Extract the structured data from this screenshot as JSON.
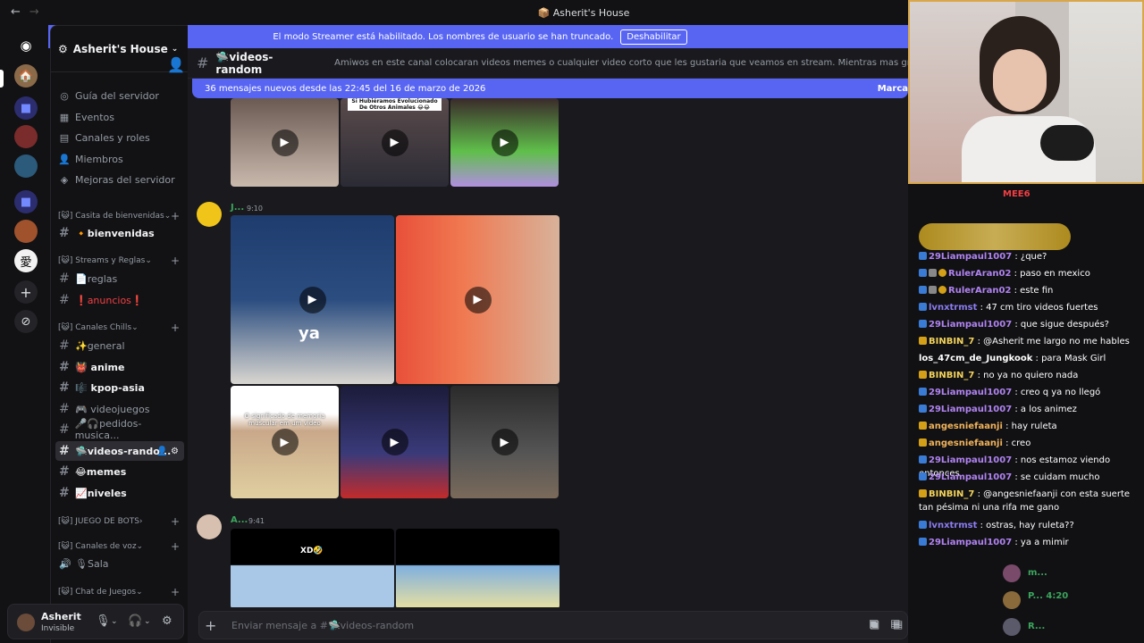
{
  "window": {
    "title": "Asherit's House",
    "back": "←",
    "forward": "→"
  },
  "streamer_banner": {
    "text": "El modo Streamer está habilitado. Los nombres de usuario se han truncado.",
    "button": "Deshabilitar"
  },
  "server": {
    "name": "Asherit's House"
  },
  "server_menu": [
    {
      "icon": "◎",
      "label": "Guía del servidor"
    },
    {
      "icon": "▦",
      "label": "Eventos"
    },
    {
      "icon": "▤",
      "label": "Canales y roles"
    },
    {
      "icon": "👤",
      "label": "Miembros"
    },
    {
      "icon": "◈",
      "label": "Mejoras del servidor"
    }
  ],
  "categories": {
    "c1": "[😺] Casita de bienvenidas",
    "c2": "[😺] Streams y Reglas",
    "c3": "[😺] Canales Chills",
    "c4": "[😺] JUEGO DE BOTS",
    "c5": "[😺] Canales de voz",
    "c6": "[😺] Chat de Juegos"
  },
  "channels": {
    "bienvenidas": "🔸bienvenidas",
    "reglas": "📄reglas",
    "anuncios": "❗anuncios❗",
    "general": "✨general",
    "anime": "👹 anime",
    "kpop": "🎼 kpop-asia",
    "videojuegos": "🎮 videojuegos",
    "pedidos": "🎤🎧pedidos-musica...",
    "videos": "🛸videos-rando...",
    "memes": "😂memes",
    "niveles": "📈niveles",
    "sala": "🎙Sala"
  },
  "user": {
    "name": "Asherit",
    "status": "Invisible"
  },
  "channel_header": {
    "name": "🛸videos-random",
    "topic": "Amiwos en este canal colocaran videos memes o cualquier video corto que les gustaria que veamos en stream. Mientras mas graciosos mejor :3 Jaremos una recop..."
  },
  "new_messages": {
    "text": "36 mensajes nuevos desde las 22:45 del 16 de marzo de 2026",
    "action": "Marca"
  },
  "messages": [
    {
      "author": "J...",
      "time": "9:10"
    },
    {
      "author": "A...",
      "time": "9:41"
    }
  ],
  "video_captions": {
    "animals": "Si Hubiéramos Evolucionado De Otros Animales 😂😂",
    "ya": "ya",
    "memoria": "O significado de memoria muscular em um video",
    "xd": "XD🤣"
  },
  "composer": {
    "placeholder": "Enviar mensaje a #🛸videos-random"
  },
  "chat": [
    {
      "user": "29Liampaul1007",
      "text": " : ¿que?",
      "color": "#b083f0",
      "badges": [
        "#3a7bd5"
      ]
    },
    {
      "user": "RulerAran02",
      "text": " : paso en mexico",
      "color": "#b083f0",
      "badges": [
        "#3a7bd5",
        "#888888",
        "#d4a017"
      ]
    },
    {
      "user": "RulerAran02",
      "text": " : este fin",
      "color": "#b083f0",
      "badges": [
        "#3a7bd5",
        "#888888",
        "#d4a017"
      ]
    },
    {
      "user": "lvnxtrmst",
      "text": " : 47 cm tiro videos fuertes",
      "color": "#8a7cf0",
      "badges": [
        "#3a7bd5"
      ]
    },
    {
      "user": "29Liampaul1007",
      "text": " : que sigue después?",
      "color": "#b083f0",
      "badges": [
        "#3a7bd5"
      ]
    },
    {
      "user": "BINBIN_7",
      "text": " : @Asherit me largo no me hables",
      "color": "#f3d35b",
      "badges": [
        "#d4a017"
      ]
    },
    {
      "user": "los_47cm_de_Jungkook",
      "text": " : para Mask Girl",
      "color": "#ffffff",
      "badges": []
    },
    {
      "user": "BINBIN_7",
      "text": " : no ya no quiero nada",
      "color": "#f3d35b",
      "badges": [
        "#d4a017"
      ]
    },
    {
      "user": "29Liampaul1007",
      "text": " : creo q ya no llegó",
      "color": "#b083f0",
      "badges": [
        "#3a7bd5"
      ]
    },
    {
      "user": "29Liampaul1007",
      "text": " : a los animez",
      "color": "#b083f0",
      "badges": [
        "#3a7bd5"
      ]
    },
    {
      "user": "angesniefaanji",
      "text": " : hay ruleta",
      "color": "#f0b35b",
      "badges": [
        "#d4a017"
      ]
    },
    {
      "user": "angesniefaanji",
      "text": " : creo",
      "color": "#f0b35b",
      "badges": [
        "#d4a017"
      ]
    },
    {
      "user": "29Liampaul1007",
      "text": " : nos estamoz viendo entonces",
      "color": "#b083f0",
      "badges": [
        "#3a7bd5"
      ]
    },
    {
      "user": "29Liampaul1007",
      "text": " : se cuidam mucho",
      "color": "#b083f0",
      "badges": [
        "#3a7bd5"
      ]
    },
    {
      "user": "BINBIN_7",
      "text": " : @angesniefaanji con esta suerte tan pésima ni una rifa me gano",
      "color": "#f3d35b",
      "badges": [
        "#d4a017"
      ]
    },
    {
      "user": "lvnxtrmst",
      "text": " : ostras, hay ruleta??",
      "color": "#8a7cf0",
      "badges": [
        "#3a7bd5"
      ]
    },
    {
      "user": "29Liampaul1007",
      "text": " : ya a mimir",
      "color": "#b083f0",
      "badges": [
        "#3a7bd5"
      ]
    }
  ],
  "members": [
    {
      "name": "m...",
      "color": "#3ba55c"
    },
    {
      "name": "P... 4:20",
      "color": "#3ba55c"
    },
    {
      "name": "R...",
      "color": "#3ba55c"
    }
  ],
  "colors": {
    "accent": "#5865f2",
    "bg": "#1a1a1e",
    "sidebar": "#121214",
    "online": "#3ba55c"
  }
}
